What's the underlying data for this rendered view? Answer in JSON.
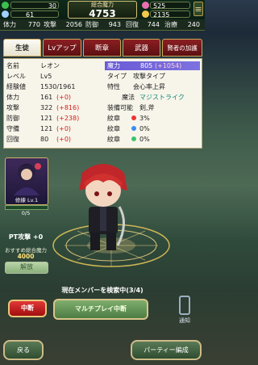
{
  "topbar": {
    "stamina": "30",
    "coins": "61",
    "power_label": "総合魔力",
    "power_value": "4753",
    "gems": "525",
    "money": "2135",
    "menu_label": "≡"
  },
  "stats_strip": [
    {
      "k": "体力",
      "v": "770"
    },
    {
      "k": "攻撃",
      "v": "2056"
    },
    {
      "k": "防御",
      "v": "943"
    },
    {
      "k": "回復",
      "v": "744"
    },
    {
      "k": "治療",
      "v": "240"
    }
  ],
  "tabs": [
    {
      "label": "生徒",
      "active": true
    },
    {
      "label": "Lvアップ"
    },
    {
      "label": "断章"
    },
    {
      "label": "武器"
    },
    {
      "label": "賢者の加護"
    }
  ],
  "status": {
    "name_k": "名前",
    "name_v": "レオン",
    "level_k": "レベル",
    "level_v": "Lv5",
    "exp_k": "経験値",
    "exp_v": "1530/1961",
    "hp_k": "体力",
    "hp_v": "161",
    "hp_b": "(+0)",
    "atk_k": "攻撃",
    "atk_v": "322",
    "atk_b": "(+816)",
    "def_k": "防御",
    "def_v": "121",
    "def_b": "(+238)",
    "res_k": "守備",
    "res_v": "121",
    "res_b": "(+0)",
    "heal_k": "回復",
    "heal_v": "80",
    "heal_b": "(+0)",
    "magic_k": "魔力",
    "magic_v": "805",
    "magic_b": "(+1054)",
    "type_k": "タイプ",
    "type_v": "攻撃タイプ",
    "trait_k": "特性",
    "trait_v": "会心率上昇",
    "magic_type_k": "魔法",
    "magic_type_v": "マジストライク",
    "equip_k": "装備可能",
    "equip_v": "剣,斧",
    "crest_k": "紋章",
    "crest1_v": "3%",
    "crest2_v": "0%",
    "crest3_v": "0%"
  },
  "card": {
    "level_text": "修練 Lv.1",
    "hp_text": "0/5",
    "pt_label": "PT攻撃 +0",
    "hint1": "おすすめ総合魔力",
    "hint2": "4000",
    "force_label": "解放"
  },
  "bottom": {
    "search_text": "現在メンバーを検索中(3/4)",
    "stop_label": "中断",
    "multi_label": "マルチプレイ中断",
    "notify_label": "通知",
    "back_label": "戻る",
    "party_label": "パーティー編成"
  },
  "colors": {
    "accent_gold": "#c9a85a",
    "tab_red": "#8b1f22",
    "highlight_purple": "#6a5bd6",
    "bonus_red": "#d71c1c"
  }
}
